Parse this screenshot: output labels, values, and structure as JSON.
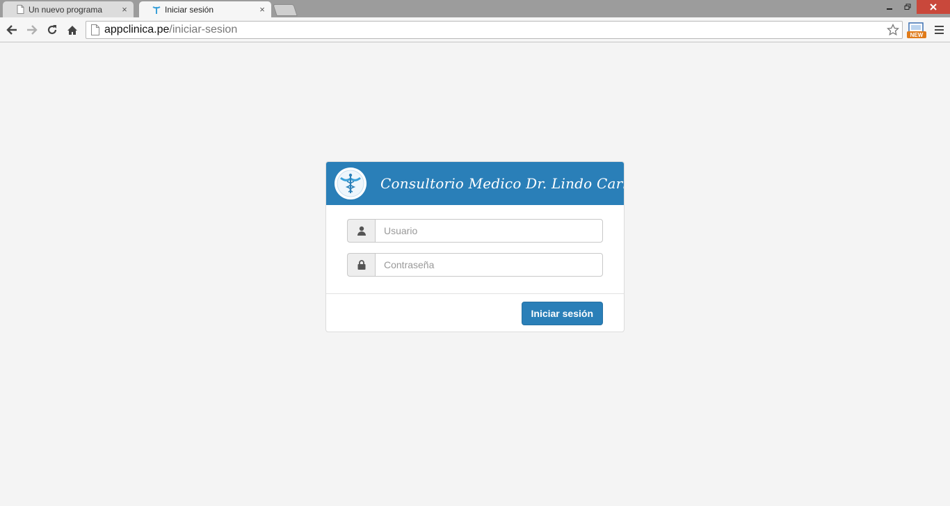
{
  "browser": {
    "tabs": [
      {
        "title": "Un nuevo programa",
        "icon": "page-icon",
        "active": false
      },
      {
        "title": "Iniciar sesión",
        "icon": "caduceus-icon",
        "active": true
      }
    ],
    "close_glyph": "×",
    "address": {
      "host": "appclinica.pe",
      "path": "/iniciar-sesion"
    },
    "extension_badge": "NEW"
  },
  "login": {
    "clinic_name": "Consultorio Medico Dr. Lindo Carlin",
    "username_placeholder": "Usuario",
    "password_placeholder": "Contraseña",
    "submit_label": "Iniciar sesión"
  },
  "colors": {
    "brand": "#2a7fb8",
    "page_background": "#f4f4f4"
  }
}
